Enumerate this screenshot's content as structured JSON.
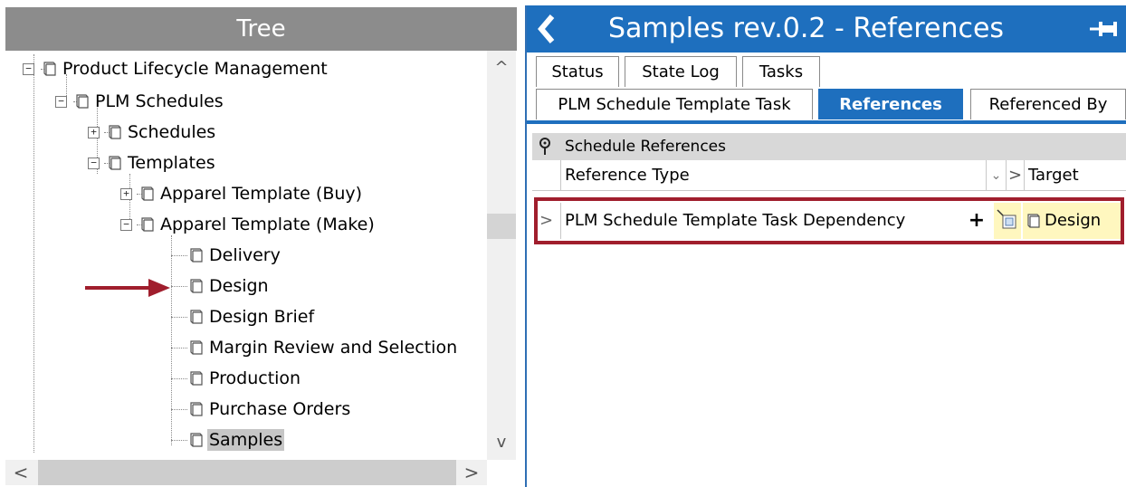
{
  "tree": {
    "title": "Tree",
    "items": [
      {
        "label": "Product Lifecycle Management",
        "toggle": "−"
      },
      {
        "label": "PLM Schedules",
        "toggle": "−"
      },
      {
        "label": "Schedules",
        "toggle": "+"
      },
      {
        "label": "Templates",
        "toggle": "−"
      },
      {
        "label": "Apparel Template (Buy)",
        "toggle": "+"
      },
      {
        "label": "Apparel Template (Make)",
        "toggle": "−"
      },
      {
        "label": "Delivery"
      },
      {
        "label": "Design"
      },
      {
        "label": "Design Brief"
      },
      {
        "label": "Margin Review and Selection"
      },
      {
        "label": "Production"
      },
      {
        "label": "Purchase Orders"
      },
      {
        "label": "Samples",
        "selected": true
      }
    ],
    "scroll_up": "^",
    "scroll_down": "v",
    "scroll_left": "<",
    "scroll_right": ">"
  },
  "annotation_color": "#a01e2d",
  "panel": {
    "title": "Samples rev.0.2 - References",
    "accent_color": "#1e6fbe",
    "back_icon": "chevron-left-icon",
    "pin_icon": "pin-icon",
    "tabs_row1": [
      "Status",
      "State Log",
      "Tasks"
    ],
    "tabs_row2": [
      "PLM Schedule Template Task",
      "References",
      "Referenced By"
    ],
    "active_tab": "References",
    "section_title": "Schedule References",
    "columns": {
      "reference_type": "Reference Type",
      "target": "Target"
    },
    "row": {
      "expander": ">",
      "reference_type": "PLM Schedule Template Task Dependency",
      "add": "+",
      "target": "Design"
    }
  }
}
